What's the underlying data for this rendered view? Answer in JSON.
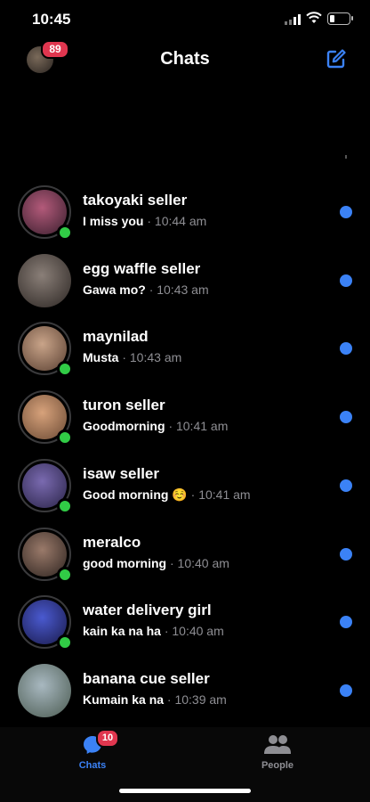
{
  "status_bar": {
    "time": "10:45"
  },
  "header": {
    "title": "Chats",
    "profile_badge": "89",
    "compose_icon": "compose-icon"
  },
  "chats": [
    {
      "name": "takoyaki seller",
      "message": "I miss you",
      "time": "· 10:44 am",
      "online": true,
      "unread": true,
      "colors": [
        "#b35a7a",
        "#3a1f2e"
      ]
    },
    {
      "name": "egg waffle seller",
      "message": "Gawa mo?",
      "time": "· 10:43 am",
      "online": false,
      "unread": true,
      "colors": [
        "#8a7f78",
        "#2b2522"
      ]
    },
    {
      "name": "maynilad",
      "message": "Musta",
      "time": "· 10:43 am",
      "online": true,
      "unread": true,
      "colors": [
        "#c9a489",
        "#5a4032"
      ]
    },
    {
      "name": "turon seller",
      "message": "Goodmorning",
      "time": "· 10:41 am",
      "online": true,
      "unread": true,
      "colors": [
        "#d7a27b",
        "#6b4a34"
      ]
    },
    {
      "name": "isaw seller",
      "message": "Good morning ☺️",
      "time": "· 10:41 am",
      "online": true,
      "unread": true,
      "colors": [
        "#7a6ab0",
        "#2a2448"
      ]
    },
    {
      "name": "meralco",
      "message": "good morning",
      "time": "· 10:40 am",
      "online": true,
      "unread": true,
      "colors": [
        "#9a7a6a",
        "#2e2420"
      ]
    },
    {
      "name": "water delivery girl",
      "message": "kain ka na ha",
      "time": "· 10:40 am",
      "online": true,
      "unread": true,
      "colors": [
        "#4a5ad0",
        "#1a1a4a"
      ]
    },
    {
      "name": "banana cue seller",
      "message": "Kumain ka na",
      "time": "· 10:39 am",
      "online": false,
      "unread": true,
      "colors": [
        "#a8b8c0",
        "#4a5a50"
      ]
    }
  ],
  "tabbar": {
    "chats_label": "Chats",
    "chats_badge": "10",
    "people_label": "People"
  },
  "colors": {
    "accent": "#3b82f6",
    "online": "#31cc46",
    "badge": "#e0364f"
  }
}
